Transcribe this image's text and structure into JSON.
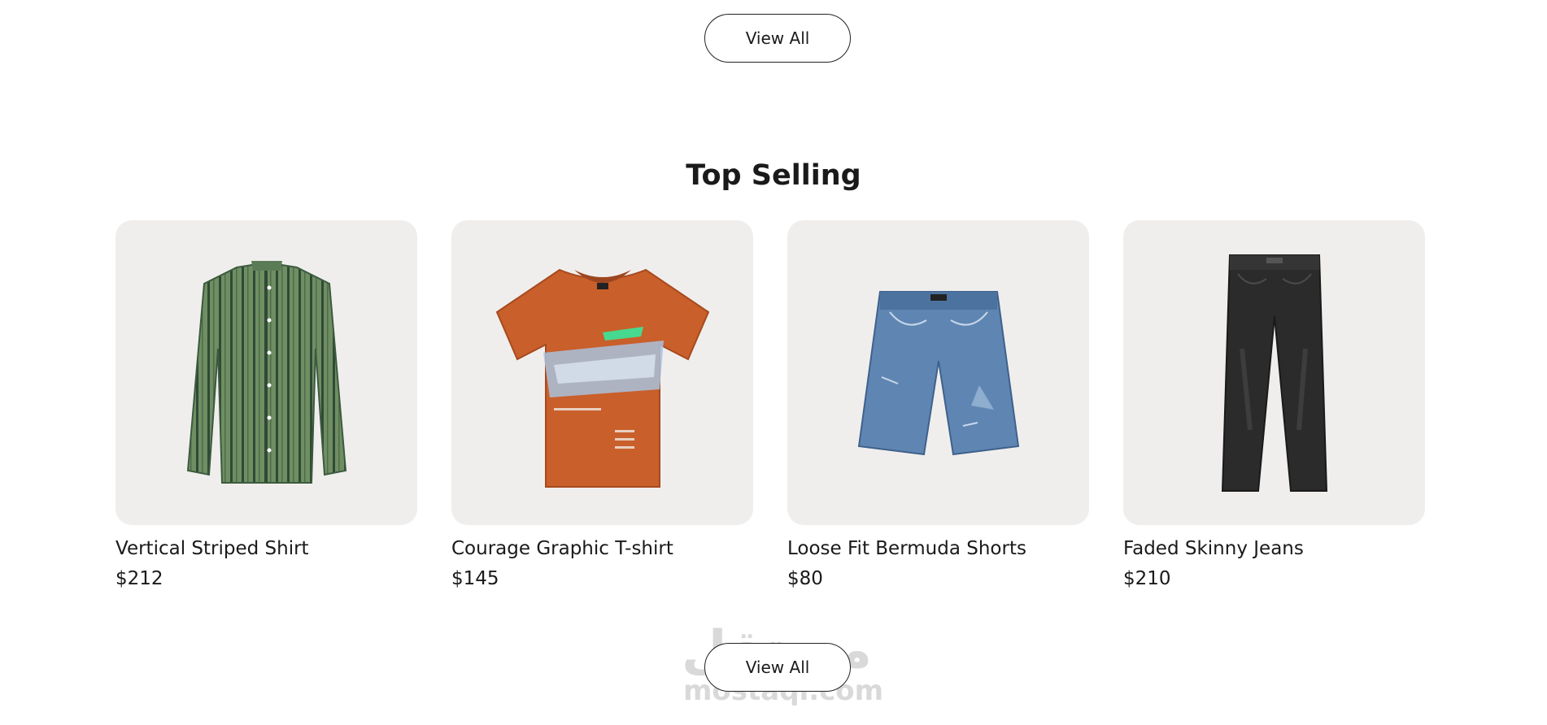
{
  "top_button": {
    "label": "View All"
  },
  "section": {
    "title": "Top Selling"
  },
  "products": [
    {
      "name": "Vertical Striped Shirt",
      "price": "$212",
      "icon": "striped-shirt-image"
    },
    {
      "name": "Courage Graphic T-shirt",
      "price": "$145",
      "icon": "graphic-tshirt-image"
    },
    {
      "name": "Loose Fit Bermuda Shorts",
      "price": "$80",
      "icon": "denim-shorts-image"
    },
    {
      "name": "Faded Skinny Jeans",
      "price": "$210",
      "icon": "skinny-jeans-image"
    }
  ],
  "bottom_button": {
    "label": "View All"
  },
  "watermark": {
    "arabic": "مستقل",
    "latin": "mostaqi.com"
  },
  "colors": {
    "card_background": "#f0eeed",
    "text": "#1a1a1a",
    "shirt_green": "#6f8f63",
    "tshirt_orange": "#c95f2a",
    "denim_blue": "#5f86b3",
    "jeans_black": "#2b2b2b"
  }
}
